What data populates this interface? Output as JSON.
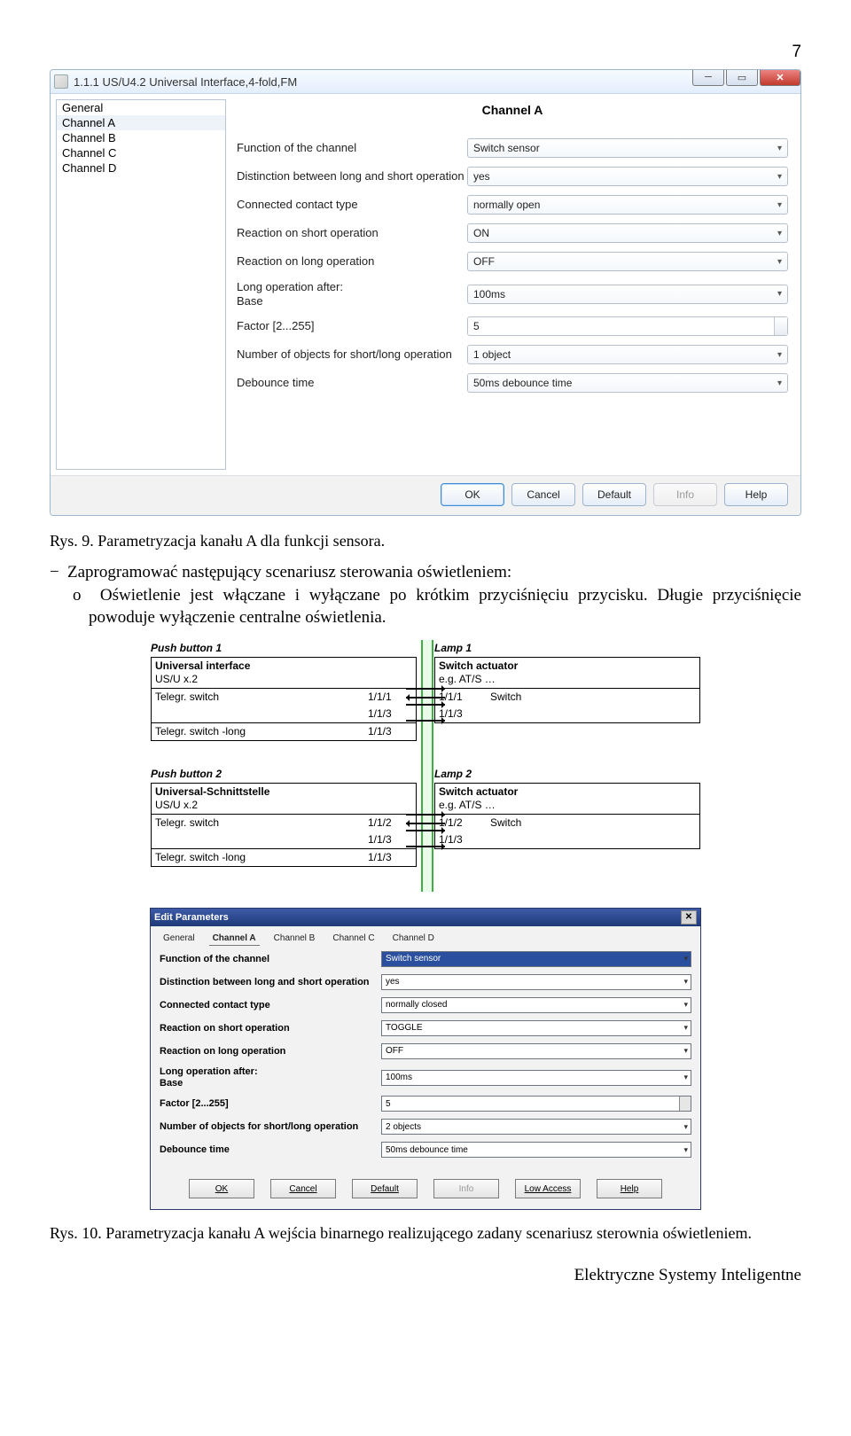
{
  "page_number": "7",
  "dialog1": {
    "title": "1.1.1 US/U4.2 Universal Interface,4-fold,FM",
    "sidebar": [
      "General",
      "Channel A",
      "Channel B",
      "Channel C",
      "Channel D"
    ],
    "selected_index": 1,
    "panel_title": "Channel A",
    "params": [
      {
        "label": "Function of the channel",
        "value": "Switch sensor",
        "type": "sel"
      },
      {
        "label": "Distinction between long and short operation",
        "value": "yes",
        "type": "sel"
      },
      {
        "label": "Connected contact type",
        "value": "normally open",
        "type": "sel"
      },
      {
        "label": "  Reaction on short operation",
        "value": "ON",
        "type": "sel"
      },
      {
        "label": "  Reaction on long operation",
        "value": "OFF",
        "type": "sel"
      },
      {
        "label": "Long operation after:\n  Base",
        "value": "100ms",
        "type": "sel"
      },
      {
        "label": "  Factor [2...255]",
        "value": "5",
        "type": "spin"
      },
      {
        "label": "Number of objects for short/long operation",
        "value": "1 object",
        "type": "sel"
      },
      {
        "label": "Debounce time",
        "value": "50ms debounce time",
        "type": "sel"
      }
    ],
    "buttons": {
      "ok": "OK",
      "cancel": "Cancel",
      "default": "Default",
      "info": "Info",
      "help": "Help"
    }
  },
  "caption1": "Rys. 9. Parametryzacja kanału A dla funkcji sensora.",
  "body_line1": "Zaprogramować następujący scenariusz sterowania oświetleniem:",
  "body_line2": "Oświetlenie jest włączane i wyłączane po krótkim przyciśnięciu przycisku. Długie przyciśnięcie powoduje wyłączenie centralne oświetlenia.",
  "diagram": {
    "pb1": {
      "title": "Push button 1",
      "b1": "Universal interface",
      "b2": "US/U x.2",
      "rows": [
        {
          "l": "Telegr. switch",
          "r": "1/1/1"
        },
        {
          "l": "",
          "r": "1/1/3"
        },
        {
          "l": "Telegr. switch -long",
          "r": "1/1/3"
        }
      ]
    },
    "lamp1": {
      "title": "Lamp 1",
      "b1": "Switch actuator",
      "b2": "e.g. AT/S …",
      "rows": [
        {
          "r": "1/1/1",
          "l": "Switch"
        },
        {
          "r": "1/1/3",
          "l": ""
        }
      ]
    },
    "pb2": {
      "title": "Push button 2",
      "b1": "Universal-Schnittstelle",
      "b2": "US/U x.2",
      "rows": [
        {
          "l": "Telegr. switch",
          "r": "1/1/2"
        },
        {
          "l": "",
          "r": "1/1/3"
        },
        {
          "l": "Telegr. switch -long",
          "r": "1/1/3"
        }
      ]
    },
    "lamp2": {
      "title": "Lamp 2",
      "b1": "Switch actuator",
      "b2": "e.g. AT/S …",
      "rows": [
        {
          "r": "1/1/2",
          "l": "Switch"
        },
        {
          "r": "1/1/3",
          "l": ""
        }
      ]
    }
  },
  "dialog2": {
    "title": "Edit Parameters",
    "tabs": [
      "General",
      "Channel A",
      "Channel B",
      "Channel C",
      "Channel D"
    ],
    "active_tab": 1,
    "params": [
      {
        "label": "Function of the channel",
        "value": "Switch sensor",
        "type": "hl"
      },
      {
        "label": "Distinction between long and short operation",
        "value": "yes",
        "type": "sel"
      },
      {
        "label": "Connected contact type",
        "value": "normally closed",
        "type": "sel"
      },
      {
        "label": "  Reaction on short operation",
        "value": "TOGGLE",
        "type": "sel"
      },
      {
        "label": "  Reaction on long operation",
        "value": "OFF",
        "type": "sel"
      },
      {
        "label": "Long operation after:\n  Base",
        "value": "100ms",
        "type": "sel"
      },
      {
        "label": "  Factor [2...255]",
        "value": "5",
        "type": "spin"
      },
      {
        "label": "Number of objects for short/long operation",
        "value": "2 objects",
        "type": "sel"
      },
      {
        "label": "Debounce time",
        "value": "50ms debounce time",
        "type": "sel"
      }
    ],
    "buttons": {
      "ok": "OK",
      "cancel": "Cancel",
      "default": "Default",
      "info": "Info",
      "low": "Low Access",
      "help": "Help"
    }
  },
  "caption2": "Rys. 10. Parametryzacja kanału A wejścia binarnego realizującego zadany scenariusz sterownia oświetleniem.",
  "footer": "Elektryczne Systemy Inteligentne"
}
